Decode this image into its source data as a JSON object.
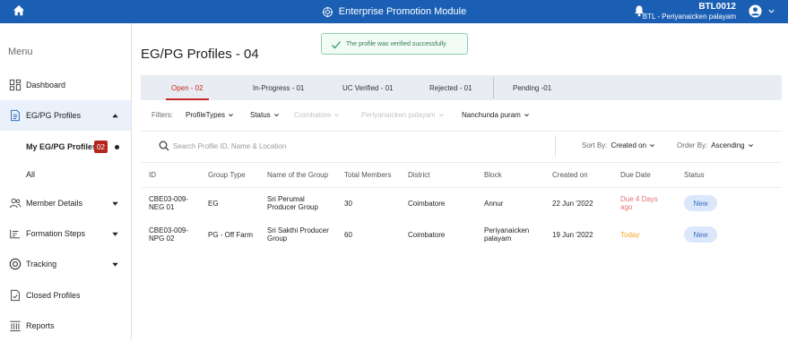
{
  "topbar": {
    "title": "Enterprise Promotion Module",
    "user_id": "BTL0012",
    "user_location": "BTL - Periyanaicken palayam"
  },
  "sidebar": {
    "menu_label": "Menu",
    "items": [
      {
        "label": "Dashboard",
        "icon": "dashboard-icon"
      },
      {
        "label": "EG/PG Profiles",
        "icon": "document-icon",
        "expanded": true
      },
      {
        "label": "Member Details",
        "icon": "users-icon"
      },
      {
        "label": "Formation Steps",
        "icon": "steps-icon"
      },
      {
        "label": "Tracking",
        "icon": "tracking-icon"
      },
      {
        "label": "Closed Profiles",
        "icon": "closed-file-icon"
      },
      {
        "label": "Reports",
        "icon": "reports-icon"
      }
    ],
    "sub_items": [
      {
        "label": "My EG/PG Profiles",
        "badge": "02"
      },
      {
        "label": "All"
      }
    ]
  },
  "page": {
    "title": "EG/PG Profiles - 04",
    "toast": "The profile was verified successfully"
  },
  "tabs": [
    {
      "label": "Open - 02",
      "active": true
    },
    {
      "label": "In-Progress - 01"
    },
    {
      "label": "UC Verified - 01"
    },
    {
      "label": "Rejected - 01"
    },
    {
      "label": "Pending -01"
    }
  ],
  "filters": {
    "label": "Filters:",
    "items": [
      {
        "label": "ProfileTypes",
        "enabled": true
      },
      {
        "label": "Status",
        "enabled": true
      },
      {
        "label": "Coimbatore",
        "enabled": false
      },
      {
        "label": "Periyanaicken palayam",
        "enabled": false
      },
      {
        "label": "Nanchunda puram",
        "enabled": true
      }
    ]
  },
  "search": {
    "placeholder": "Search Profile ID, Name & Location"
  },
  "sort": {
    "label": "Sort By:",
    "value": "Created on"
  },
  "order": {
    "label": "Order By:",
    "value": "Ascending"
  },
  "table": {
    "headers": [
      "ID",
      "Group Type",
      "Name of the Group",
      "Total Members",
      "District",
      "Block",
      "Created on",
      "Due Date",
      "Status"
    ],
    "rows": [
      {
        "id": [
          "CBE03-009-",
          "NEG 01"
        ],
        "group_type": "EG",
        "name": [
          "Sri Perumal",
          "Producer Group"
        ],
        "members": "30",
        "district": "Coimbatore",
        "block": [
          "Annur"
        ],
        "created": "22 Jun '2022",
        "due": [
          "Due 4 Days",
          "ago"
        ],
        "due_color": "#e57373",
        "status": "New"
      },
      {
        "id": [
          "CBE03-009-",
          "NPG 02"
        ],
        "group_type": "PG - Off Farm",
        "name": [
          "Sri Sakthi Producer",
          "Group"
        ],
        "members": "60",
        "district": "Coimbatore",
        "block": [
          "Periyanaicken",
          "palayam"
        ],
        "created": "19 Jun '2022",
        "due": [
          "Today"
        ],
        "due_color": "#f5a623",
        "status": "New"
      }
    ]
  },
  "colors": {
    "brand": "#1a5fb4",
    "accent": "#c62828",
    "success": "#2e7d4f"
  }
}
